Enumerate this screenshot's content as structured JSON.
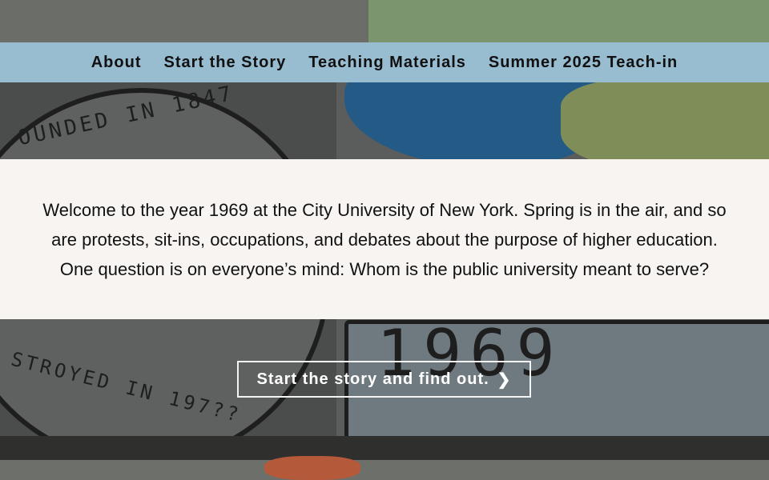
{
  "nav": {
    "items": [
      {
        "label": "About"
      },
      {
        "label": "Start the Story"
      },
      {
        "label": "Teaching Materials"
      },
      {
        "label": "Summer 2025 Teach-in"
      }
    ]
  },
  "welcome": {
    "text": "Welcome to the year 1969 at the City University of New York. Spring is in the air, and so are protests, sit-ins, occupations, and debates about the purpose of higher education. One question is on everyone’s mind: Whom is the public university meant to serve?"
  },
  "cta": {
    "label": "Start the story and find out.",
    "icon": "chevron-right-icon"
  },
  "background": {
    "text_founded": "OUNDED IN 1847",
    "text_destroyed": "STROYED IN 197??",
    "text_year": "1969"
  },
  "colors": {
    "nav_bg": "#98bcd0",
    "welcome_bg": "#f8f4f2",
    "cta_border": "#f4f4f4"
  }
}
